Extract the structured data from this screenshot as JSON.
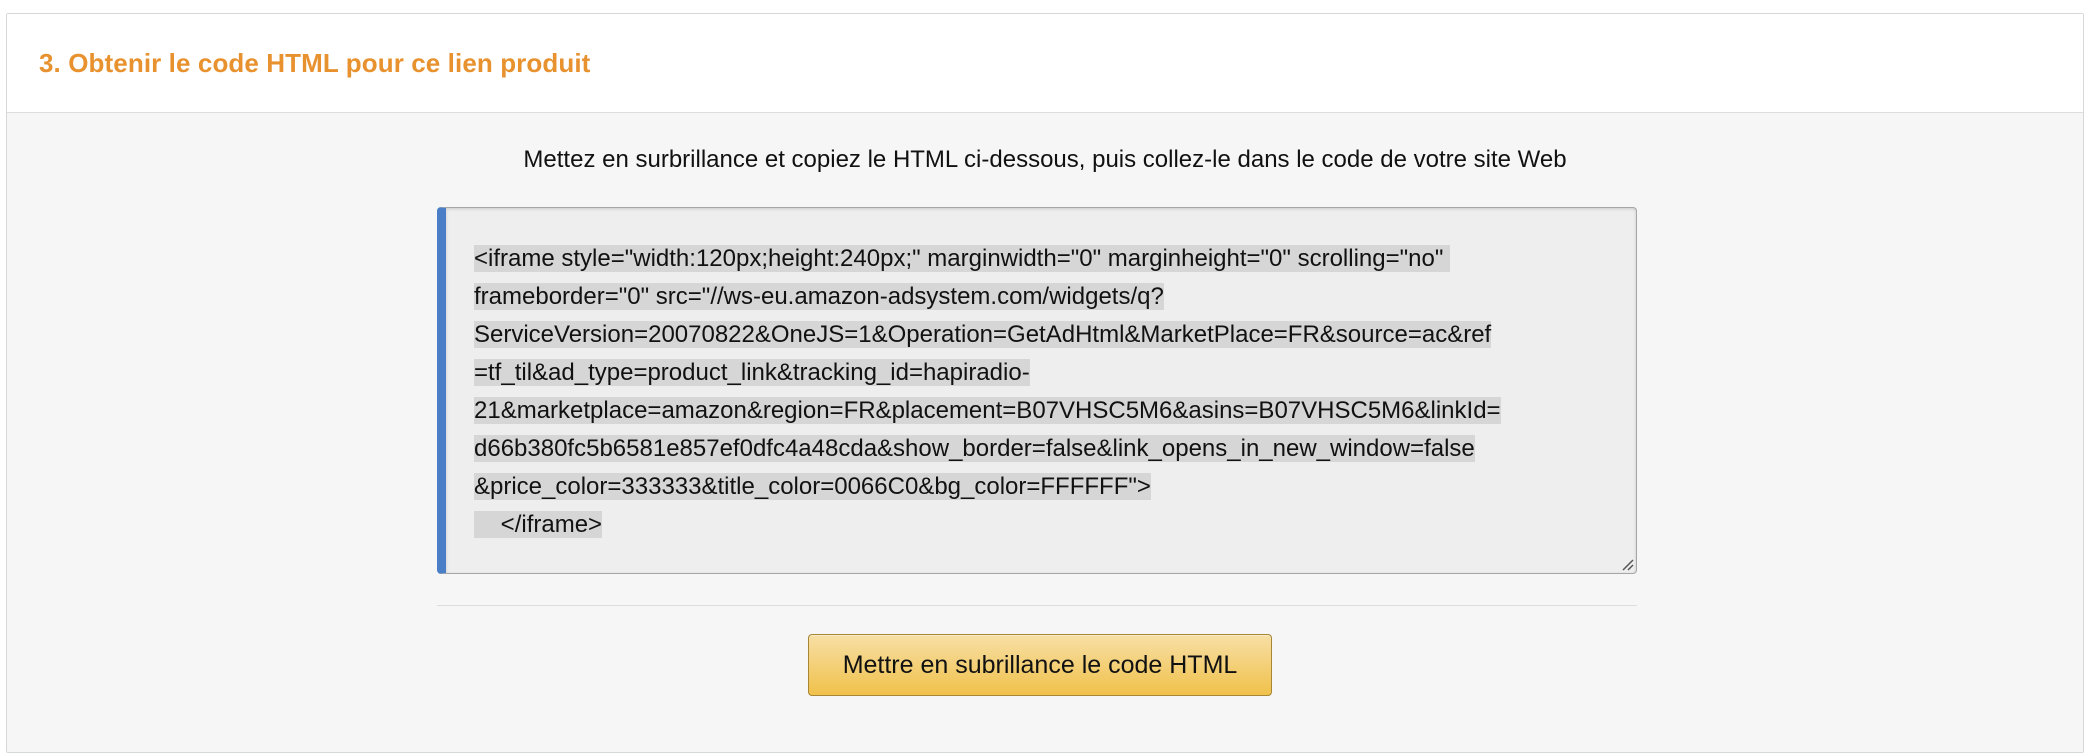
{
  "section": {
    "title": "3. Obtenir le code HTML pour ce lien produit",
    "title_color": "#e8922f"
  },
  "instructions": "Mettez en surbrillance et copiez le HTML ci-dessous, puis collez-le dans le code de votre site Web",
  "code_box": {
    "accent_color": "#4a7fc8",
    "lines": [
      "<iframe style=\"width:120px;height:240px;\" marginwidth=\"0\" marginheight=\"0\" scrolling=\"no\" ",
      "frameborder=\"0\" src=\"//ws-eu.amazon-adsystem.com/widgets/q?",
      "ServiceVersion=20070822&OneJS=1&Operation=GetAdHtml&MarketPlace=FR&source=ac&ref",
      "=tf_til&ad_type=product_link&tracking_id=hapiradio-",
      "21&marketplace=amazon&region=FR&placement=B07VHSC5M6&asins=B07VHSC5M6&linkId=",
      "d66b380fc5b6581e857ef0dfc4a48cda&show_border=false&link_opens_in_new_window=false",
      "&price_color=333333&title_color=0066C0&bg_color=FFFFFF\">",
      "    </iframe>"
    ]
  },
  "highlight_button": {
    "label": "Mettre en subrillance le code HTML",
    "color": "#f0c14b"
  }
}
